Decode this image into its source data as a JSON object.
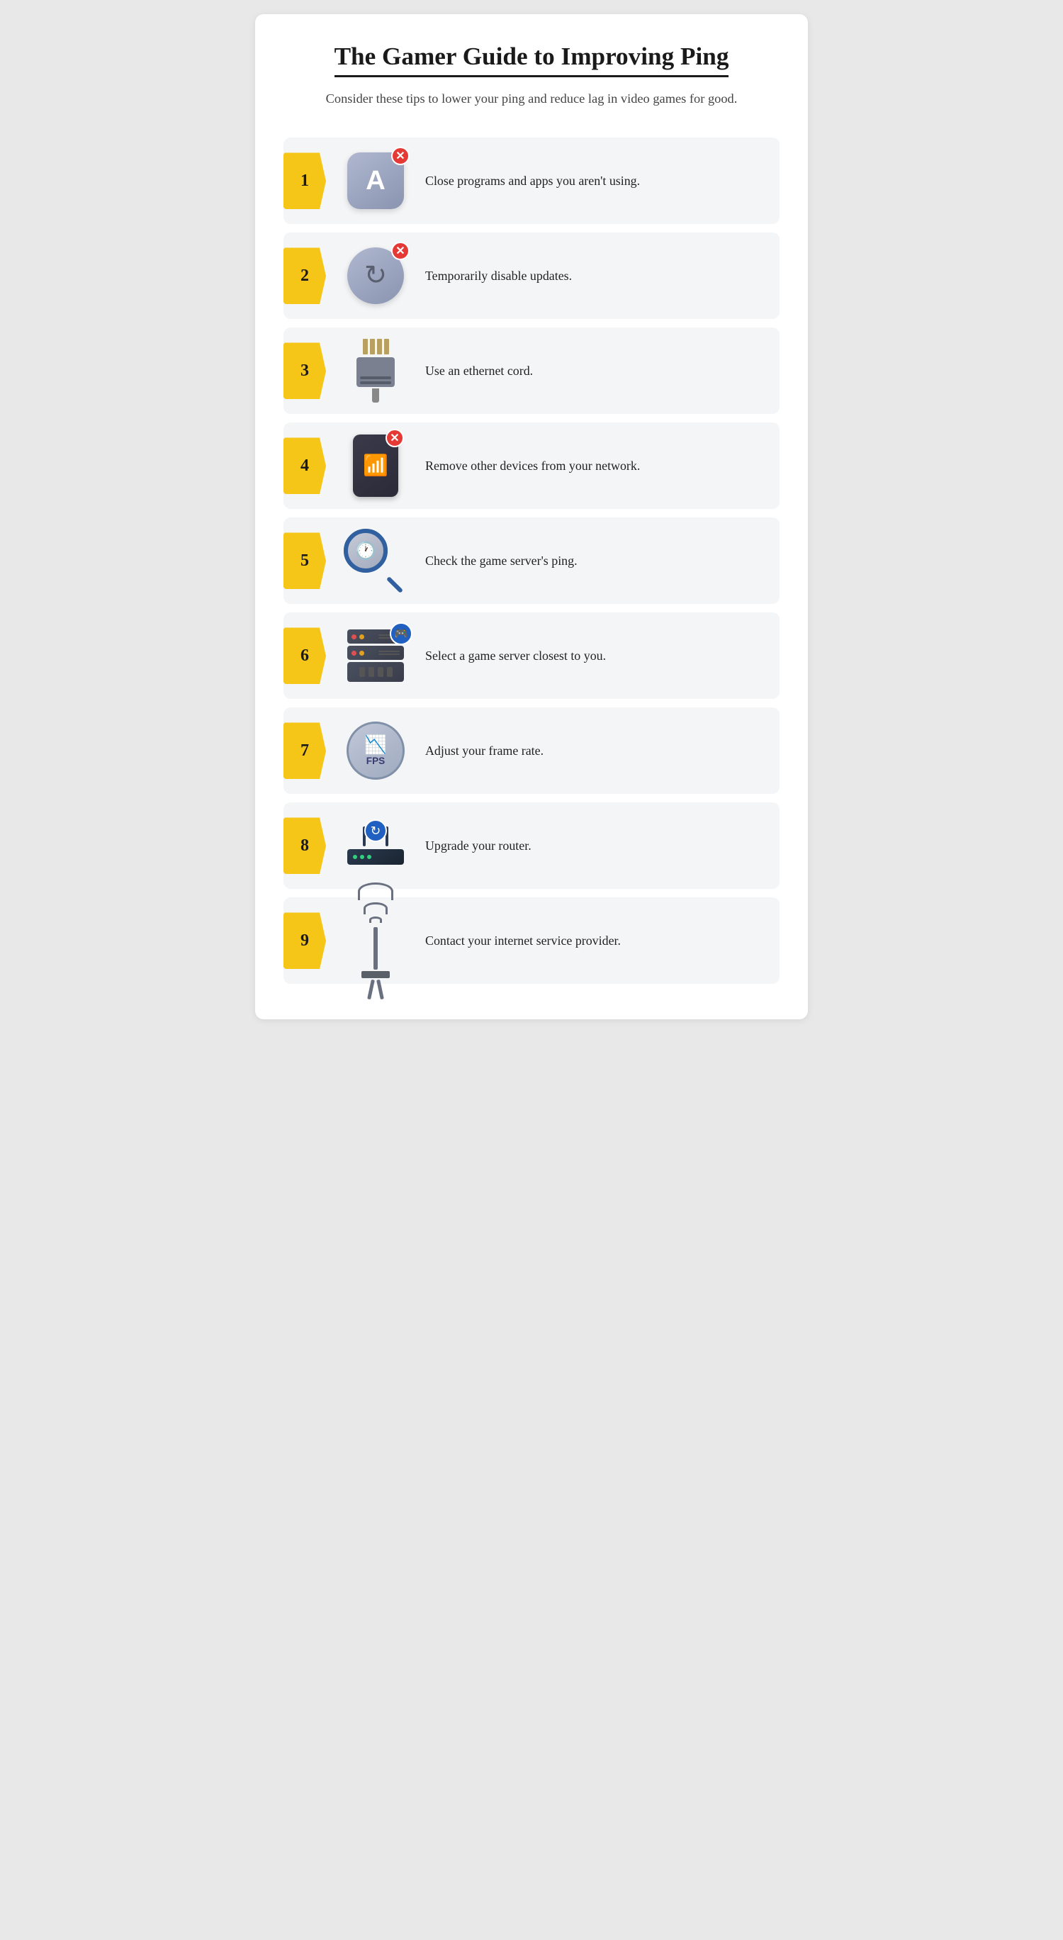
{
  "header": {
    "title": "The Gamer Guide to Improving Ping",
    "subtitle": "Consider these tips to lower your ping and reduce lag in video games for good."
  },
  "items": [
    {
      "number": "1",
      "text": "Close programs and apps you aren't using.",
      "icon_type": "app",
      "aria": "close-programs-icon"
    },
    {
      "number": "2",
      "text": "Temporarily disable updates.",
      "icon_type": "update",
      "aria": "disable-updates-icon"
    },
    {
      "number": "3",
      "text": "Use an ethernet cord.",
      "icon_type": "ethernet",
      "aria": "ethernet-cord-icon"
    },
    {
      "number": "4",
      "text": "Remove other devices from your network.",
      "icon_type": "phone",
      "aria": "remove-devices-icon"
    },
    {
      "number": "5",
      "text": "Check the game server's ping.",
      "icon_type": "search",
      "aria": "check-ping-icon"
    },
    {
      "number": "6",
      "text": "Select a game server closest to you.",
      "icon_type": "server",
      "aria": "game-server-icon"
    },
    {
      "number": "7",
      "text": "Adjust your frame rate.",
      "icon_type": "fps",
      "aria": "frame-rate-icon"
    },
    {
      "number": "8",
      "text": "Upgrade your router.",
      "icon_type": "router",
      "aria": "router-icon"
    },
    {
      "number": "9",
      "text": "Contact your internet service provider.",
      "icon_type": "tower",
      "aria": "isp-tower-icon"
    }
  ],
  "colors": {
    "badge_yellow": "#f5c518",
    "card_bg": "#f4f5f7",
    "accent_blue": "#2060c0",
    "accent_red": "#e53935"
  }
}
